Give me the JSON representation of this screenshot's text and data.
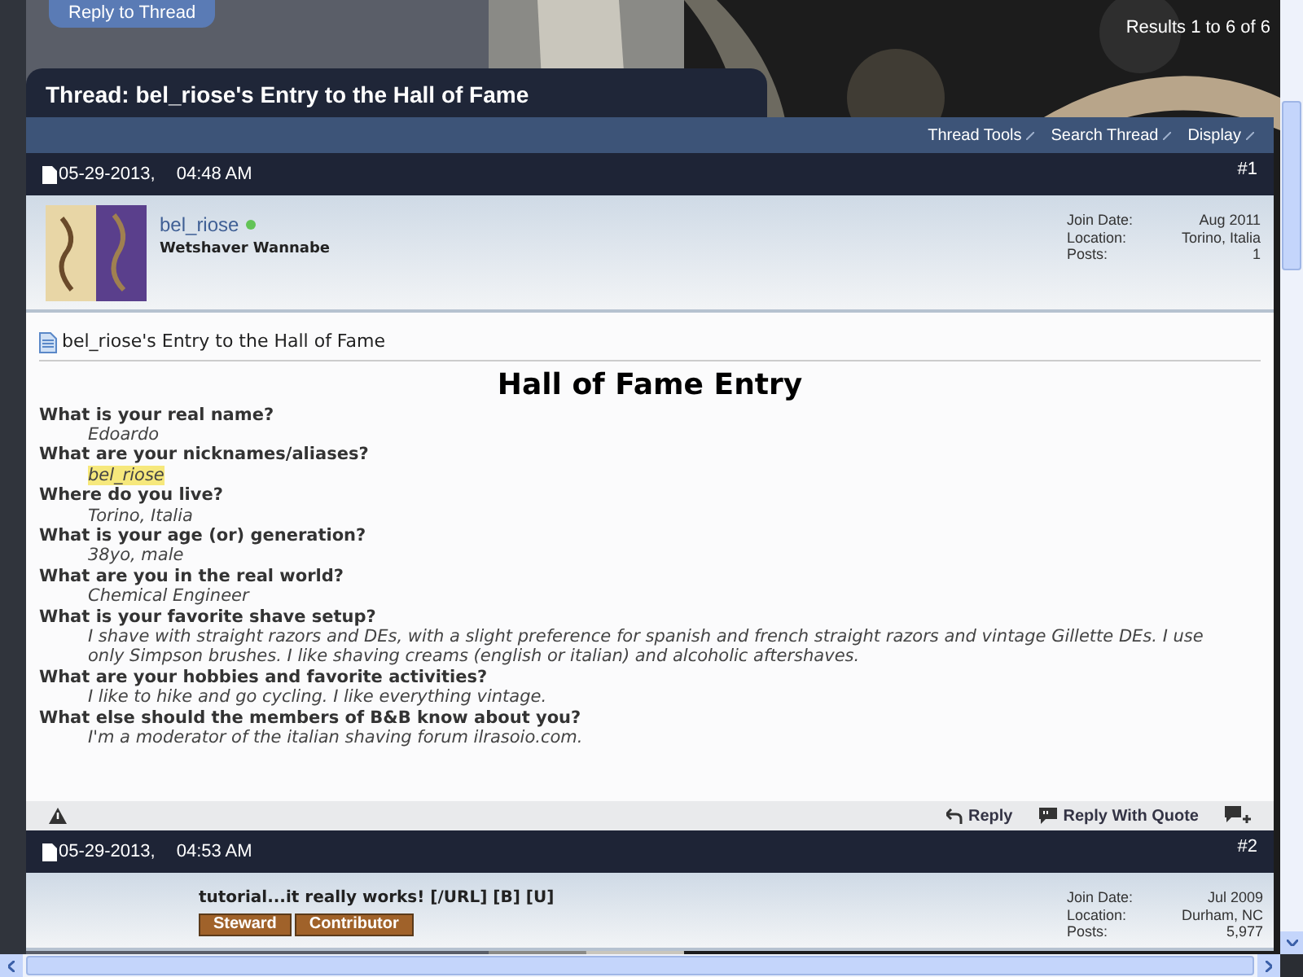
{
  "top_button": "Reply to Thread",
  "results": "Results 1 to 6 of 6",
  "thread_title": "Thread: bel_riose's Entry to the Hall of Fame",
  "toolbar": [
    "Thread Tools",
    "Search Thread",
    "Display"
  ],
  "posts": [
    {
      "date": "05-29-2013,",
      "time": "04:48 AM",
      "number": "#1",
      "user": {
        "name": "bel_riose",
        "online": true,
        "title": "Wetshaver Wannabe"
      },
      "details": [
        {
          "label": "Join Date:",
          "value": "Aug 2011"
        },
        {
          "label": "Location:",
          "value": "Torino, Italia"
        },
        {
          "label": "Posts:",
          "value": "1"
        }
      ],
      "post_title": "bel_riose's Entry to the Hall of Fame",
      "heading": "Hall of Fame Entry",
      "qa": [
        {
          "q": "What is your real name?",
          "a": "Edoardo",
          "highlighted": false
        },
        {
          "q": "What are your nicknames/aliases?",
          "a": "bel_riose",
          "highlighted": true
        },
        {
          "q": "Where do you live?",
          "a": "Torino, Italia",
          "highlighted": false
        },
        {
          "q": "What is your age (or) generation?",
          "a": "38yo, male",
          "highlighted": false
        },
        {
          "q": "What are you in the real world?",
          "a": "Chemical Engineer",
          "highlighted": false
        },
        {
          "q": "What is your favorite shave setup?",
          "a": "I shave with straight razors and DEs, with a slight preference for spanish and french straight razors and vintage Gillette DEs. I use only Simpson brushes. I like shaving creams (english or italian) and alcoholic aftershaves.",
          "highlighted": false
        },
        {
          "q": "What are your hobbies and favorite activities?",
          "a": "I like to hike and go cycling. I like everything vintage.",
          "highlighted": false
        },
        {
          "q": "What else should the members of B&B know about you?",
          "a": "I'm a moderator of the italian shaving forum ilrasoio.com.",
          "highlighted": false
        }
      ],
      "actions": [
        "Reply",
        "Reply With Quote"
      ]
    },
    {
      "date": "05-29-2013,",
      "time": "04:53 AM",
      "number": "#2",
      "details": [
        {
          "label": "Join Date:",
          "value": "Jul 2009"
        },
        {
          "label": "Location:",
          "value": "Durham, NC"
        },
        {
          "label": "Posts:",
          "value": "5,977"
        }
      ],
      "signature": "tutorial...it really works! [/URL] [B] [U]",
      "badges": [
        "Steward",
        "Contributor"
      ]
    }
  ]
}
